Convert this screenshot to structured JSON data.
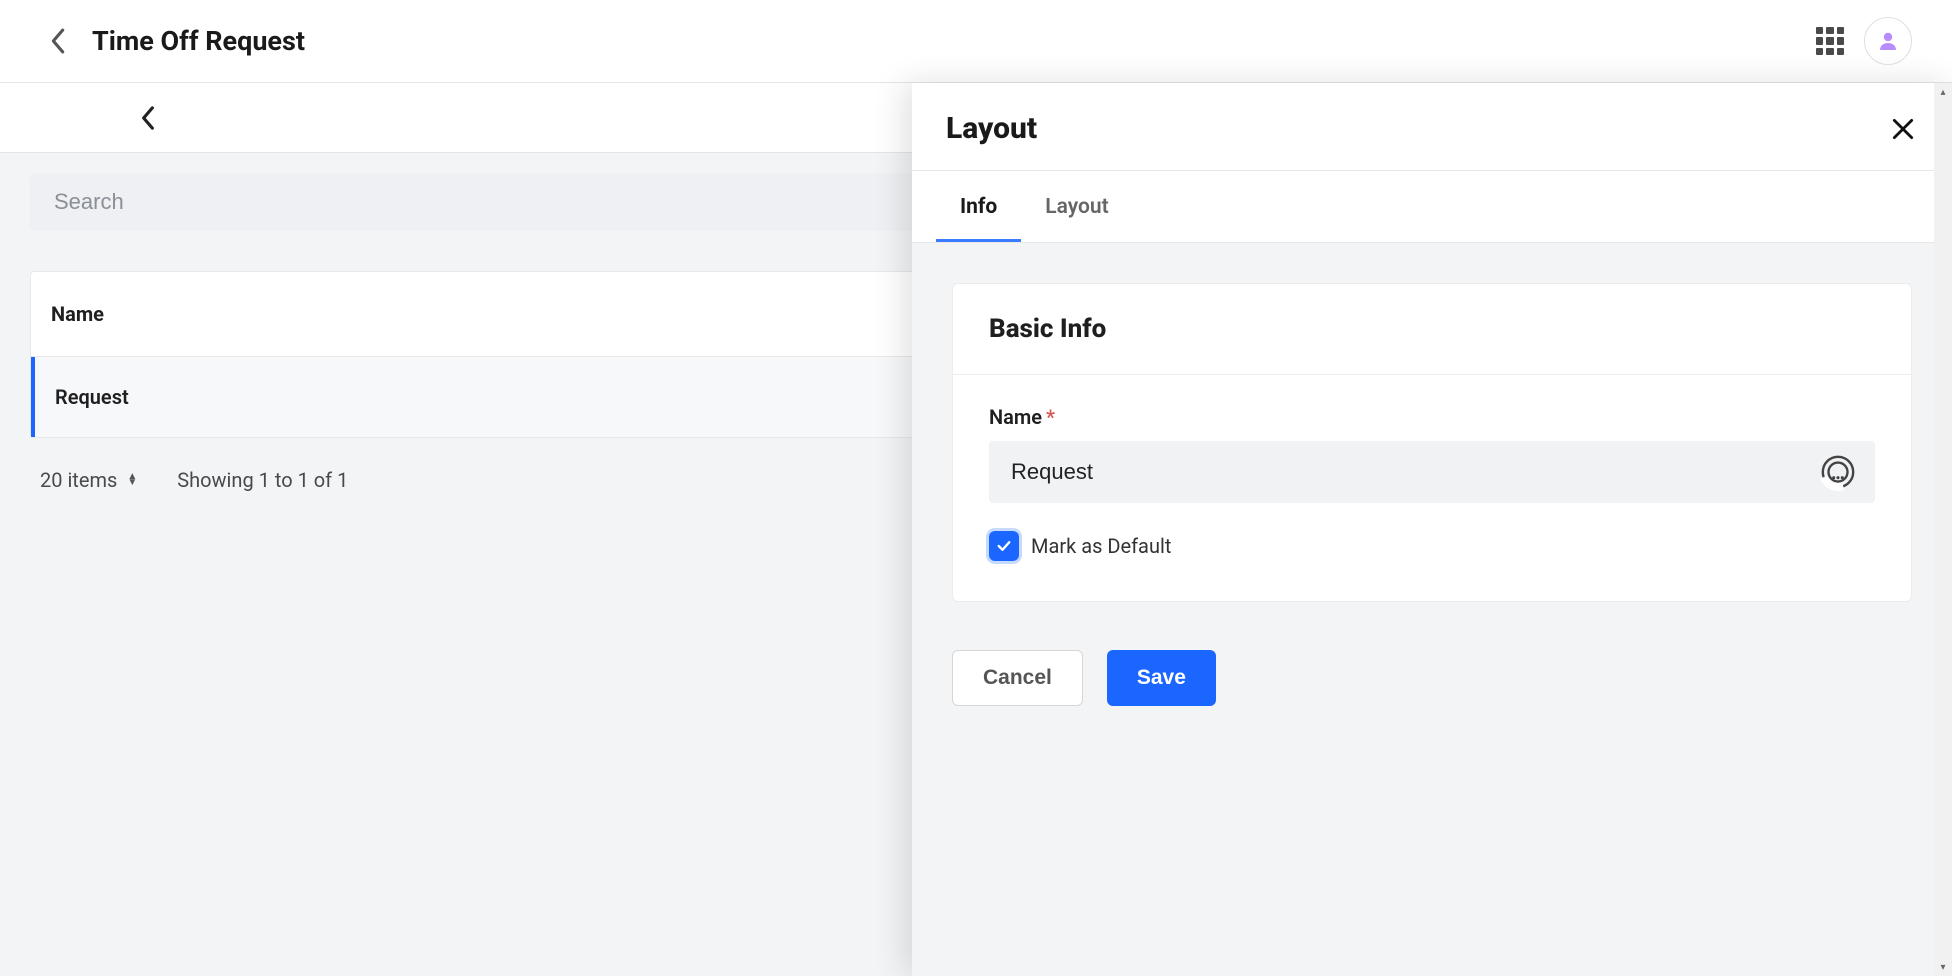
{
  "topbar": {
    "title": "Time Off Request"
  },
  "search": {
    "placeholder": "Search"
  },
  "table": {
    "header": "Name",
    "rows": [
      "Request"
    ]
  },
  "pager": {
    "items_label": "20 items",
    "showing": "Showing 1 to 1 of 1"
  },
  "panel": {
    "title": "Layout",
    "tabs": [
      {
        "label": "Info",
        "active": true
      },
      {
        "label": "Layout",
        "active": false
      }
    ],
    "card_title": "Basic Info",
    "name_label": "Name",
    "name_value": "Request",
    "default_label": "Mark as Default",
    "default_checked": true,
    "cancel": "Cancel",
    "save": "Save"
  }
}
